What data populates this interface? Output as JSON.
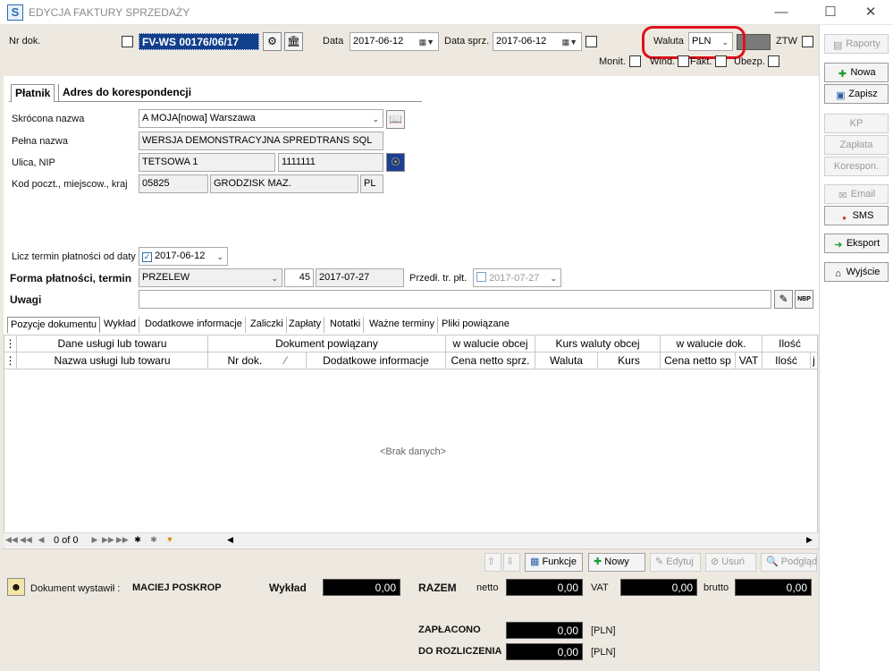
{
  "window": {
    "title": "EDYCJA FAKTURY SPRZEDAŻY",
    "app_icon": "S"
  },
  "header": {
    "nr_dok_label": "Nr dok.",
    "nr_dok_value": "FV-WS 00176/06/17",
    "data_label": "Data",
    "data_value": "2017-06-12",
    "data_sprz_label": "Data sprz.",
    "data_sprz_value": "2017-06-12",
    "waluta_label": "Waluta",
    "waluta_value": "PLN",
    "ztw_label": "ZTW",
    "monit_label": "Monit.",
    "wind_label": "Wind.",
    "fakt_label": "Fakt.",
    "ubezp_label": "Ubezp."
  },
  "tabs_top": [
    "Płatnik",
    "Adres do korespondencji"
  ],
  "platnik": {
    "skrocona_label": "Skrócona nazwa",
    "skrocona_value": "A MOJA[nowa] Warszawa",
    "pelna_label": "Pełna nazwa",
    "pelna_value": "WERSJA DEMONSTRACYJNA SPREDTRANS SQL",
    "ulica_label": "Ulica, NIP",
    "ulica_value": "TETSOWA 1",
    "nip_value": "1111111",
    "kod_label": "Kod poczt., miejscow., kraj",
    "kod_value": "05825",
    "miejscowosc_value": "GRODZISK MAZ.",
    "kraj_value": "PL"
  },
  "payment": {
    "licz_label": "Licz termin płatności od daty",
    "licz_date": "2017-06-12",
    "forma_label": "Forma płatności, termin",
    "forma_value": "PRZELEW",
    "days_value": "45",
    "termin_value": "2017-07-27",
    "predl_label": "Przedł. tr. płt.",
    "predl_value": "2017-07-27",
    "uwagi_label": "Uwagi",
    "uwagi_value": "",
    "nbp_label": "NBP"
  },
  "tabs_bottom": [
    "Pozycje dokumentu",
    "Wykład",
    "Dodatkowe informacje",
    "Zaliczki",
    "Zapłaty",
    "Notatki",
    "Ważne terminy",
    "Pliki powiązane"
  ],
  "grid": {
    "group_headers": [
      "Dane usługi lub towaru",
      "Dokument powiązany",
      "w walucie obcej",
      "Kurs waluty obcej",
      "w walucie dok.",
      "Ilość"
    ],
    "columns": [
      "Nazwa usługi lub towaru",
      "Nr dok.",
      "Dodatkowe informacje",
      "Cena netto sprz.",
      "Waluta",
      "Kurs",
      "Cena netto sp",
      "VAT",
      "Ilość",
      "j"
    ],
    "sort_indicator": "⁄",
    "empty_text": "<Brak danych>",
    "record_counter": "0 of 0"
  },
  "grid_buttons": {
    "funkcje": "Funkcje",
    "nowy": "Nowy",
    "edytuj": "Edytuj",
    "usun": "Usuń",
    "podglad": "Podgląd"
  },
  "footer": {
    "wystawil_label": "Dokument wystawił :",
    "wystawil_value": "MACIEJ POSKROP",
    "wyklad_label": "Wykład",
    "wyklad_value": "0,00",
    "razem_label": "RAZEM",
    "netto_label": "netto",
    "netto_value": "0,00",
    "vat_label": "VAT",
    "vat_value": "0,00",
    "brutto_label": "brutto",
    "brutto_value": "0,00",
    "zaplacono_label": "ZAPŁACONO",
    "zaplacono_value": "0,00",
    "zaplacono_cur": "[PLN]",
    "do_rozliczenia_label": "DO ROZLICZENIA",
    "do_rozliczenia_value": "0,00",
    "do_rozliczenia_cur": "[PLN]"
  },
  "right_toolbar": {
    "raporty": "Raporty",
    "nowa": "Nowa",
    "zapisz": "Zapisz",
    "kp": "KP",
    "zaplata": "Zapłata",
    "korespon": "Korespon.",
    "email": "Email",
    "sms": "SMS",
    "eksport": "Eksport",
    "wyjscie": "Wyjście"
  },
  "colors": {
    "docnum_bg": "#123f8c",
    "highlight_oval": "#e0101a",
    "panel_bg": "#ede9e0"
  }
}
